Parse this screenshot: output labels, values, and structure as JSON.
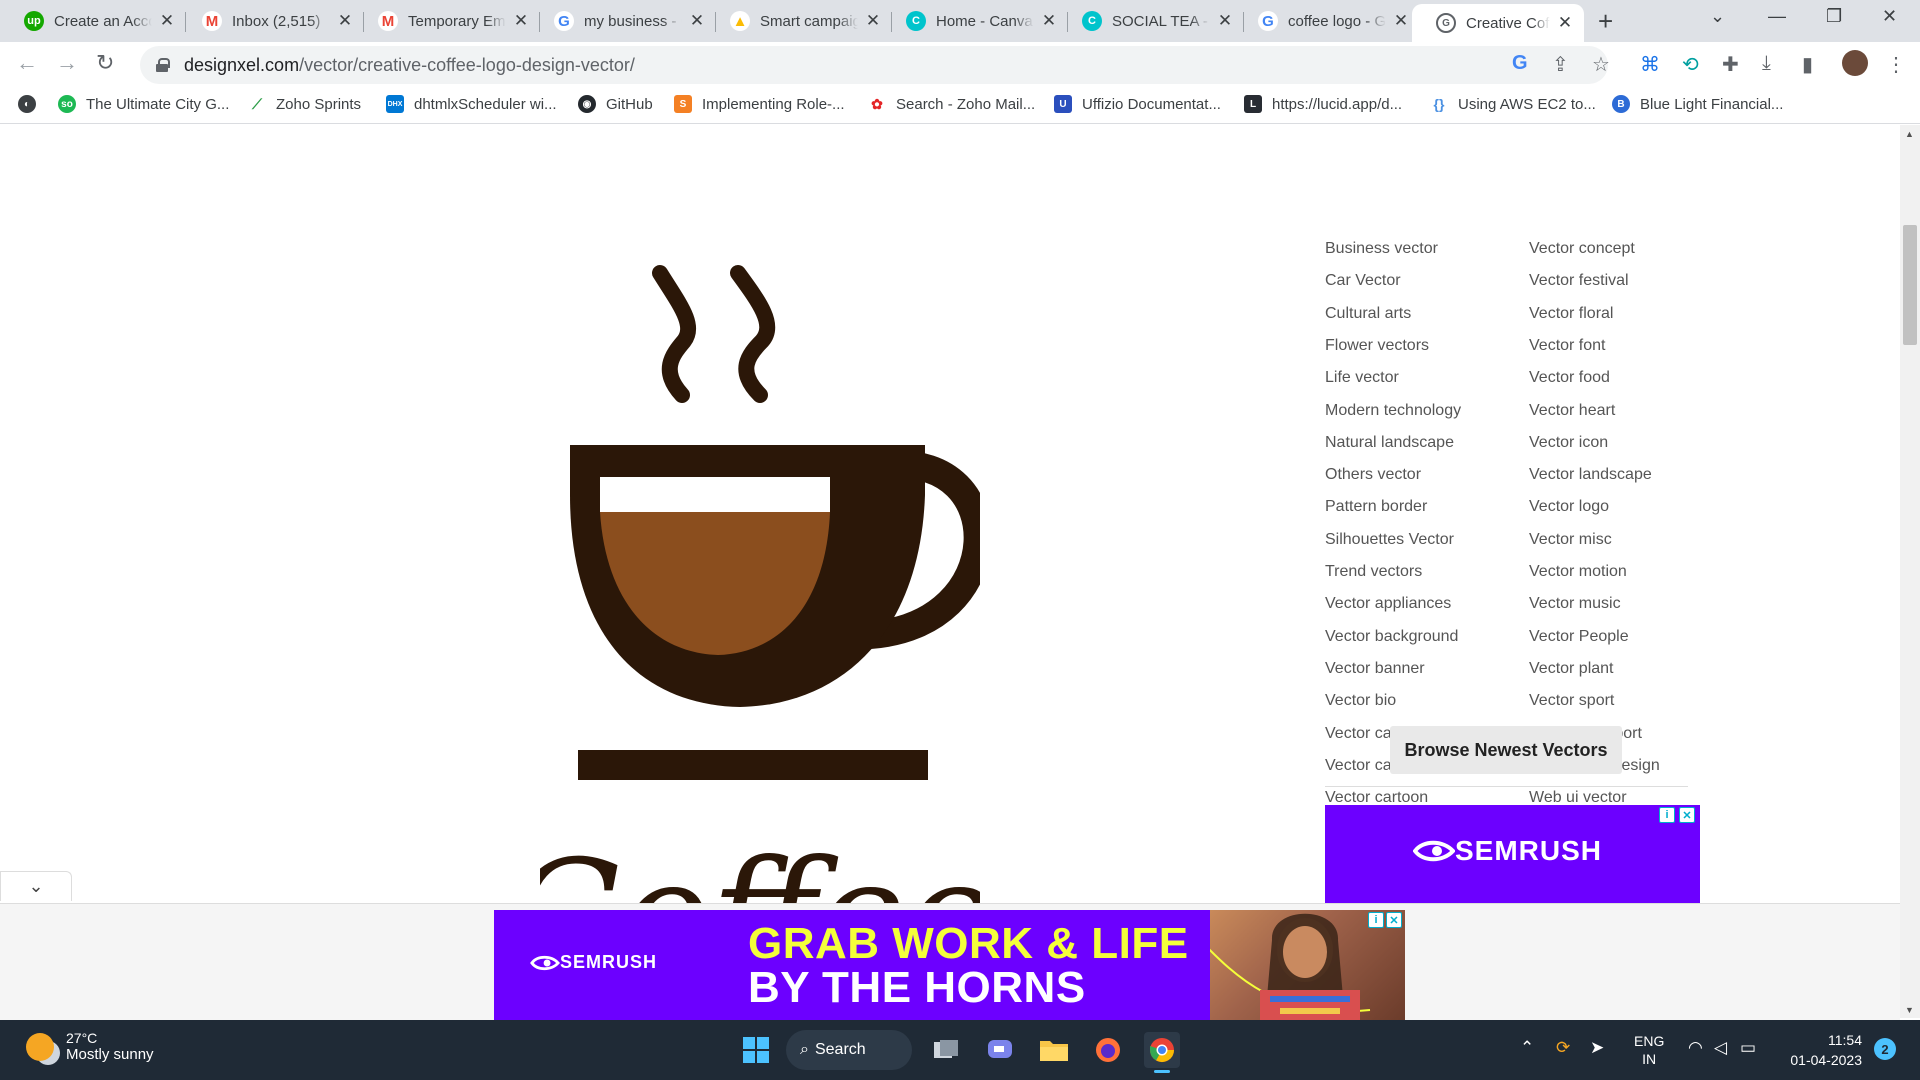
{
  "browser": {
    "tabs": [
      {
        "title": "Create an Account",
        "icon": "upwork-icon",
        "color": "#14a800"
      },
      {
        "title": "Inbox (2,515)",
        "icon": "gmail-icon",
        "color": "#ea4335"
      },
      {
        "title": "Temporary Email",
        "icon": "gmail-icon",
        "color": "#ea4335"
      },
      {
        "title": "my business - Google",
        "icon": "google-icon",
        "color": "#4285f4"
      },
      {
        "title": "Smart campaigns",
        "icon": "google-ads-icon",
        "color": "#fbbc04"
      },
      {
        "title": "Home - Canva",
        "icon": "canva-icon",
        "color": "#00c4cc"
      },
      {
        "title": "SOCIAL TEA - Canva",
        "icon": "canva-icon",
        "color": "#00c4cc"
      },
      {
        "title": "coffee logo - Google",
        "icon": "google-icon",
        "color": "#4285f4"
      },
      {
        "title": "Creative Coffee Logo",
        "icon": "designxel-icon",
        "color": "#5f6368"
      }
    ],
    "active_tab_index": 8,
    "url_domain": "designxel.com",
    "url_path": "/vector/creative-coffee-logo-design-vector/",
    "bookmarks": [
      {
        "label": "The Ultimate City G...",
        "icon": "city-guide-icon",
        "color": "#1db954"
      },
      {
        "label": "Zoho Sprints",
        "icon": "zoho-sprints-icon",
        "color": "#2e9e49"
      },
      {
        "label": "dhtmlxScheduler wi...",
        "icon": "dhtmlx-icon",
        "color": "#0078d4"
      },
      {
        "label": "GitHub",
        "icon": "github-icon",
        "color": "#24292e"
      },
      {
        "label": "Implementing Role-...",
        "icon": "stackoverflow-icon",
        "color": "#f48024"
      },
      {
        "label": "Search - Zoho Mail...",
        "icon": "zoho-mail-icon",
        "color": "#e42527"
      },
      {
        "label": "Uffizio Documentat...",
        "icon": "uffizio-icon",
        "color": "#2b4fbd"
      },
      {
        "label": "https://lucid.app/d...",
        "icon": "lucid-icon",
        "color": "#282c33"
      },
      {
        "label": "Using AWS EC2 to...",
        "icon": "aws-icon",
        "color": "#4a90e2"
      },
      {
        "label": "Blue Light Financial...",
        "icon": "blue-light-icon",
        "color": "#2d6bd6"
      }
    ]
  },
  "page": {
    "logo_word": "Coffee",
    "categories_left": [
      "Business vector",
      "Car Vector",
      "Cultural arts",
      "Flower vectors",
      "Life vector",
      "Modern technology",
      "Natural landscape",
      "Others vector",
      "Pattern border",
      "Silhouettes Vector",
      "Trend vectors",
      "Vector appliances",
      "Vector background",
      "Vector banner",
      "Vector bio",
      "Vector calendar",
      "Vector card",
      "Vector cartoon"
    ],
    "categories_right": [
      "Vector concept",
      "Vector festival",
      "Vector floral",
      "Vector font",
      "Vector food",
      "Vector heart",
      "Vector icon",
      "Vector landscape",
      "Vector logo",
      "Vector misc",
      "Vector motion",
      "Vector music",
      "Vector People",
      "Vector plant",
      "Vector sport",
      "Vector transport",
      "Vector web design",
      "Web ui vector"
    ],
    "browse_button": "Browse Newest Vectors",
    "side_ad_brand": "SEMRUSH",
    "bottom_ad": {
      "brand": "SEMRUSH",
      "headline_line1": "GRAB WORK & LIFE",
      "headline_line2": "BY THE HORNS"
    },
    "colors": {
      "ad_purple": "#6c00ff",
      "coffee_dark": "#2b1708",
      "coffee_liquid": "#8b4e1e",
      "headline_yellow": "#f4ff3a"
    }
  },
  "taskbar": {
    "weather_temp": "27°C",
    "weather_desc": "Mostly sunny",
    "search_label": "Search",
    "language": "ENG",
    "region": "IN",
    "time": "11:54",
    "date": "01-04-2023",
    "notification_count": "2"
  }
}
